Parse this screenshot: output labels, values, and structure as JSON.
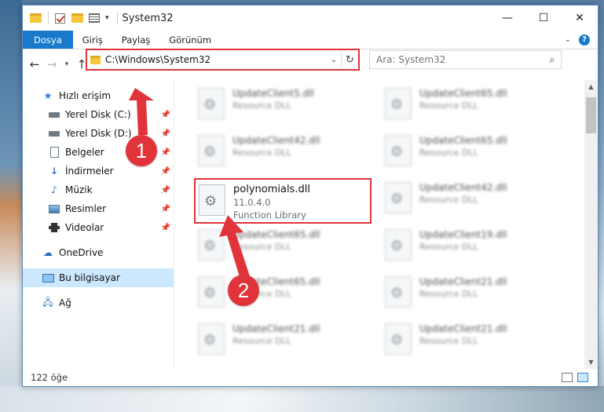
{
  "window": {
    "title": "System32",
    "controls": {
      "minimize": "—",
      "maximize": "☐",
      "close": "✕"
    }
  },
  "ribbon": {
    "tabs": [
      "Dosya",
      "Giriş",
      "Paylaş",
      "Görünüm"
    ]
  },
  "navigation": {
    "address": "C:\\Windows\\System32",
    "search_placeholder": "Ara: System32"
  },
  "sidebar": {
    "quick_access": "Hızlı erişim",
    "pinned": [
      {
        "label": "Yerel Disk (C:)",
        "icon": "drive-icon"
      },
      {
        "label": "Yerel Disk (D:)",
        "icon": "drive-icon"
      },
      {
        "label": "Belgeler",
        "icon": "document-icon"
      },
      {
        "label": "İndirmeler",
        "icon": "download-icon"
      },
      {
        "label": "Müzik",
        "icon": "music-icon"
      },
      {
        "label": "Resimler",
        "icon": "pictures-icon"
      },
      {
        "label": "Videolar",
        "icon": "video-icon"
      }
    ],
    "onedrive": "OneDrive",
    "this_pc": "Bu bilgisayar",
    "network": "Ağ"
  },
  "files": {
    "left_column": [
      {
        "name": "UpdateClient5.dll",
        "type": "Resource DLL"
      },
      {
        "name": "UpdateClient42.dll",
        "type": "Resource DLL"
      },
      {
        "name": "UpdateClient65.dll",
        "type": "Resource DLL"
      },
      {
        "name": "UpdateClient65.dll",
        "type": "Resource DLL"
      },
      {
        "name": "UpdateClient21.dll",
        "type": "Resource DLL"
      }
    ],
    "right_column": [
      {
        "name": "UpdateClient65.dll",
        "type": "Resource DLL"
      },
      {
        "name": "UpdateClient65.dll",
        "type": "Resource DLL"
      },
      {
        "name": "UpdateClient42.dll",
        "type": "Resource DLL"
      },
      {
        "name": "UpdateClient19.dll",
        "type": "Resource DLL"
      },
      {
        "name": "UpdateClient21.dll",
        "type": "Resource DLL"
      },
      {
        "name": "UpdateClient21.dll",
        "type": "Resource DLL"
      }
    ],
    "highlighted": {
      "name": "polynomials.dll",
      "version": "11.0.4.0",
      "description": "Function Library"
    }
  },
  "status": {
    "item_count": "122 öğe"
  },
  "annotations": {
    "step1": "1",
    "step2": "2",
    "color": "#e0343a"
  }
}
